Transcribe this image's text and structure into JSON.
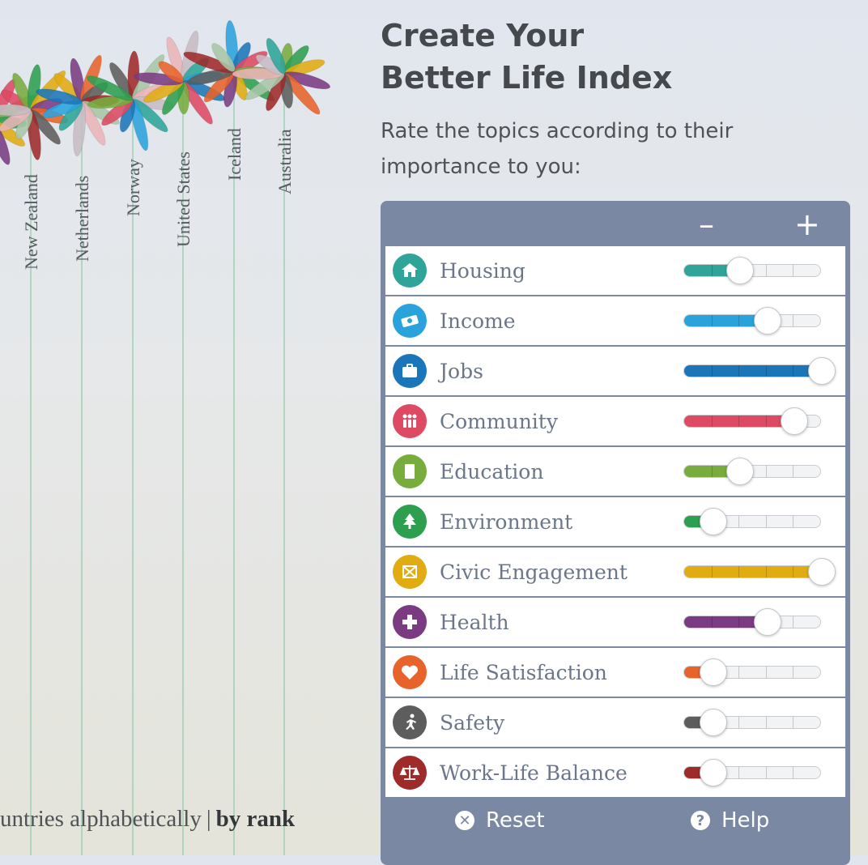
{
  "flowers": {
    "palette": [
      "#2ea598",
      "#2aa3dd",
      "#1a76b8",
      "#dd4a63",
      "#78ac3d",
      "#2e9f4e",
      "#e0ac12",
      "#7a3b82",
      "#e8632a",
      "#5d5d5d",
      "#9e2a2a",
      "#a7c6a5",
      "#e9b4b7",
      "#c6bcc4"
    ],
    "countries": [
      {
        "name": "New Zealand"
      },
      {
        "name": "Netherlands"
      },
      {
        "name": "Norway"
      },
      {
        "name": "United States"
      },
      {
        "name": "Iceland"
      },
      {
        "name": "Australia"
      }
    ]
  },
  "sort": {
    "prefix": "untries alphabetically",
    "separator": "|",
    "active": "by rank"
  },
  "header": {
    "title_line1": "Create Your",
    "title_line2": "Better Life Index",
    "subtitle": "Rate the topics according to their importance to you:"
  },
  "panel": {
    "minus_label": "–",
    "plus_label": "+",
    "topics": [
      {
        "label": "Housing",
        "icon": "house-icon",
        "color": "#2ea598",
        "level": 0.4
      },
      {
        "label": "Income",
        "icon": "banknote-icon",
        "color": "#2aa3dd",
        "level": 0.6
      },
      {
        "label": "Jobs",
        "icon": "briefcase-icon",
        "color": "#1a76b8",
        "level": 1.0
      },
      {
        "label": "Community",
        "icon": "people-icon",
        "color": "#dd4a63",
        "level": 0.8
      },
      {
        "label": "Education",
        "icon": "book-icon",
        "color": "#78ac3d",
        "level": 0.4
      },
      {
        "label": "Environment",
        "icon": "tree-icon",
        "color": "#2e9f4e",
        "level": 0.2
      },
      {
        "label": "Civic Engagement",
        "icon": "ballot-box-icon",
        "color": "#e0ac12",
        "level": 1.0
      },
      {
        "label": "Health",
        "icon": "medical-cross-icon",
        "color": "#7a3b82",
        "level": 0.6
      },
      {
        "label": "Life Satisfaction",
        "icon": "heart-icon",
        "color": "#e8632a",
        "level": 0.2
      },
      {
        "label": "Safety",
        "icon": "running-person-icon",
        "color": "#5d5d5d",
        "level": 0.2
      },
      {
        "label": "Work-Life Balance",
        "icon": "scales-icon",
        "color": "#9e2a2a",
        "level": 0.2
      }
    ],
    "reset_label": "Reset",
    "reset_icon": "close-icon",
    "help_label": "Help",
    "help_icon": "question-icon"
  }
}
